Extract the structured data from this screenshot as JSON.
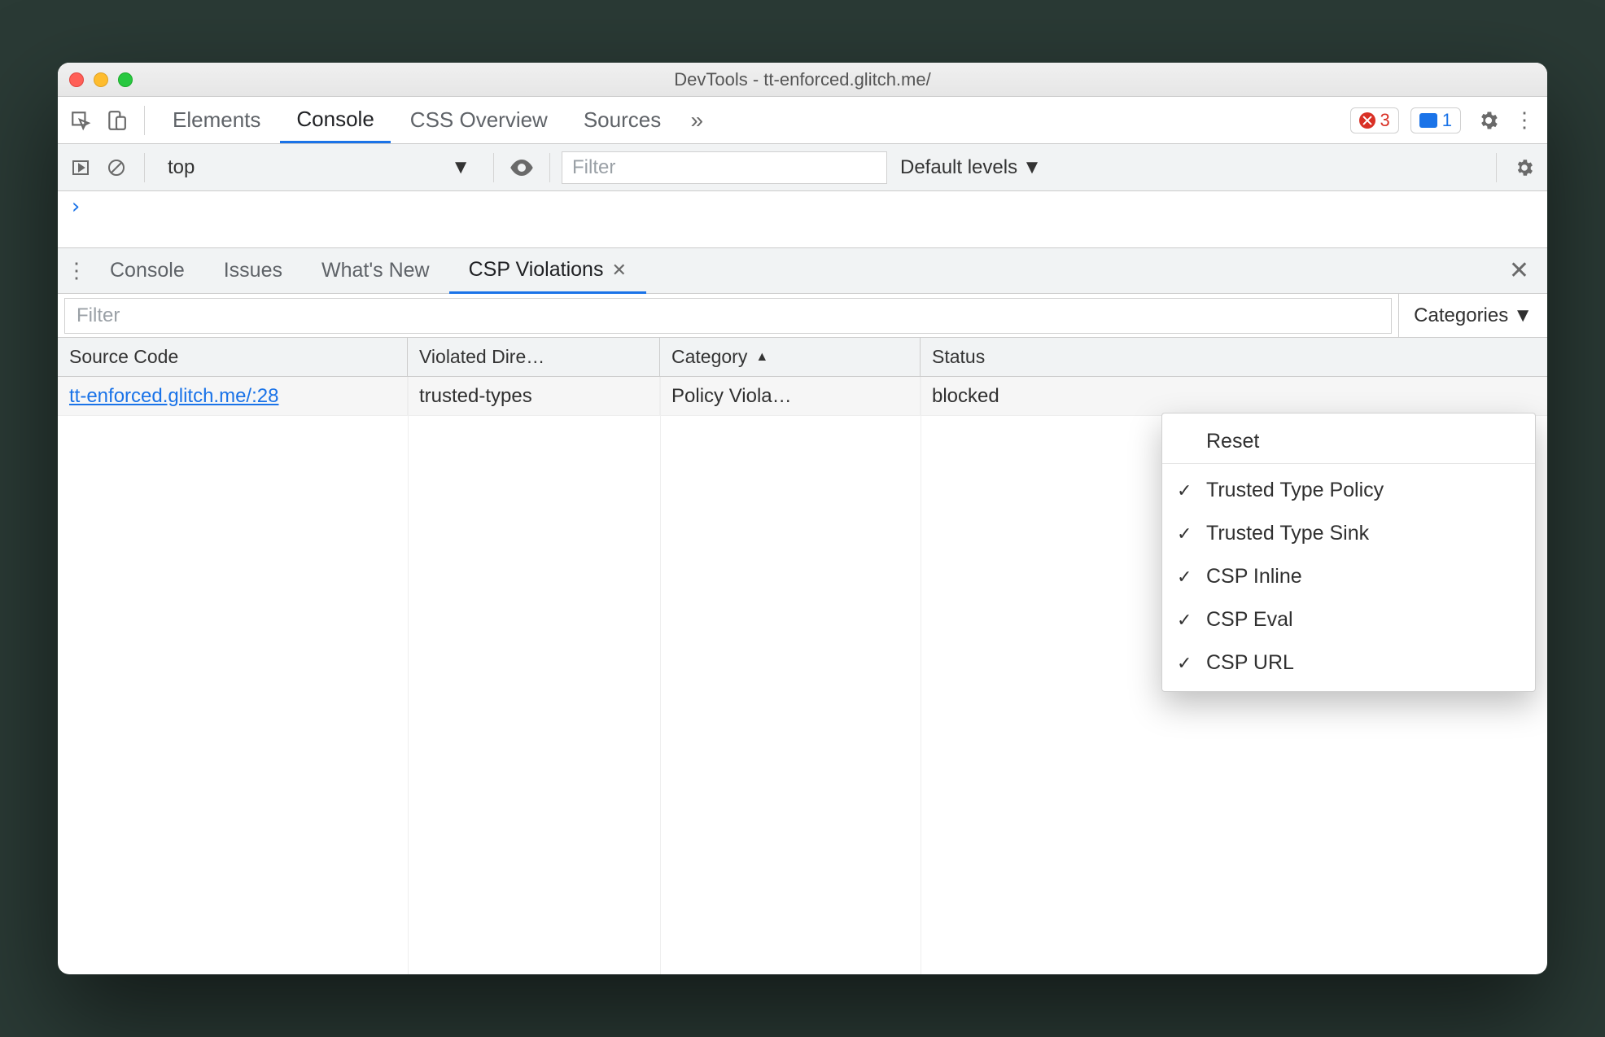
{
  "window_title": "DevTools - tt-enforced.glitch.me/",
  "main_tabs": [
    "Elements",
    "Console",
    "CSS Overview",
    "Sources"
  ],
  "main_tab_active": "Console",
  "indicators": {
    "errors": "3",
    "messages": "1"
  },
  "console_toolbar": {
    "context": "top",
    "filter_placeholder": "Filter",
    "levels_label": "Default levels"
  },
  "console_prompt": "›",
  "drawer": {
    "tabs": [
      "Console",
      "Issues",
      "What's New",
      "CSP Violations"
    ],
    "active": "CSP Violations",
    "filter_placeholder": "Filter",
    "categories_label": "Categories"
  },
  "table": {
    "columns": [
      "Source Code",
      "Violated Dire…",
      "Category",
      "Status"
    ],
    "sort_col": "Category",
    "rows": [
      {
        "source": "tt-enforced.glitch.me/:28",
        "directive": "trusted-types",
        "category": "Policy Viola…",
        "status": "blocked"
      }
    ]
  },
  "categories_menu": {
    "reset": "Reset",
    "items": [
      "Trusted Type Policy",
      "Trusted Type Sink",
      "CSP Inline",
      "CSP Eval",
      "CSP URL"
    ]
  }
}
